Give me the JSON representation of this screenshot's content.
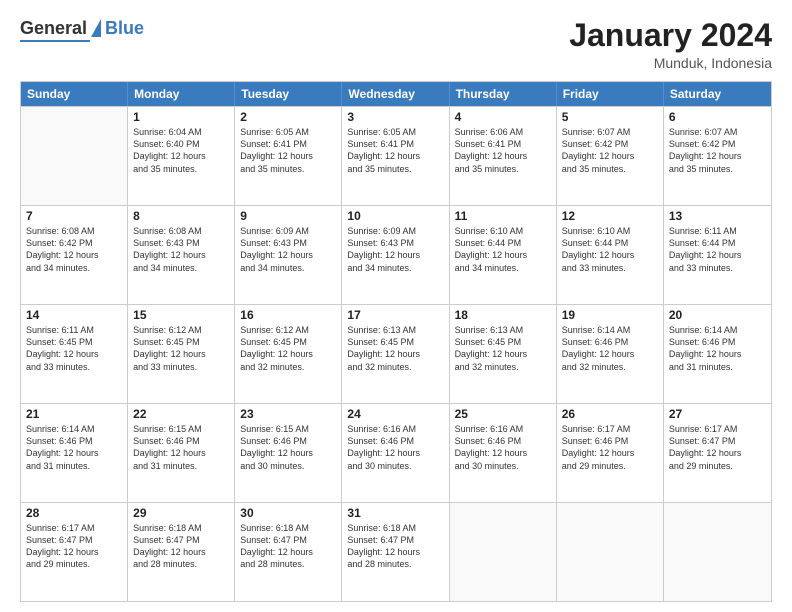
{
  "logo": {
    "general": "General",
    "blue": "Blue"
  },
  "title": "January 2024",
  "location": "Munduk, Indonesia",
  "days": [
    "Sunday",
    "Monday",
    "Tuesday",
    "Wednesday",
    "Thursday",
    "Friday",
    "Saturday"
  ],
  "rows": [
    [
      {
        "day": "",
        "empty": true
      },
      {
        "day": "1",
        "sunrise": "6:04 AM",
        "sunset": "6:40 PM",
        "daylight": "12 hours and 35 minutes."
      },
      {
        "day": "2",
        "sunrise": "6:05 AM",
        "sunset": "6:41 PM",
        "daylight": "12 hours and 35 minutes."
      },
      {
        "day": "3",
        "sunrise": "6:05 AM",
        "sunset": "6:41 PM",
        "daylight": "12 hours and 35 minutes."
      },
      {
        "day": "4",
        "sunrise": "6:06 AM",
        "sunset": "6:41 PM",
        "daylight": "12 hours and 35 minutes."
      },
      {
        "day": "5",
        "sunrise": "6:07 AM",
        "sunset": "6:42 PM",
        "daylight": "12 hours and 35 minutes."
      },
      {
        "day": "6",
        "sunrise": "6:07 AM",
        "sunset": "6:42 PM",
        "daylight": "12 hours and 35 minutes."
      }
    ],
    [
      {
        "day": "7",
        "sunrise": "6:08 AM",
        "sunset": "6:42 PM",
        "daylight": "12 hours and 34 minutes."
      },
      {
        "day": "8",
        "sunrise": "6:08 AM",
        "sunset": "6:43 PM",
        "daylight": "12 hours and 34 minutes."
      },
      {
        "day": "9",
        "sunrise": "6:09 AM",
        "sunset": "6:43 PM",
        "daylight": "12 hours and 34 minutes."
      },
      {
        "day": "10",
        "sunrise": "6:09 AM",
        "sunset": "6:43 PM",
        "daylight": "12 hours and 34 minutes."
      },
      {
        "day": "11",
        "sunrise": "6:10 AM",
        "sunset": "6:44 PM",
        "daylight": "12 hours and 34 minutes."
      },
      {
        "day": "12",
        "sunrise": "6:10 AM",
        "sunset": "6:44 PM",
        "daylight": "12 hours and 33 minutes."
      },
      {
        "day": "13",
        "sunrise": "6:11 AM",
        "sunset": "6:44 PM",
        "daylight": "12 hours and 33 minutes."
      }
    ],
    [
      {
        "day": "14",
        "sunrise": "6:11 AM",
        "sunset": "6:45 PM",
        "daylight": "12 hours and 33 minutes."
      },
      {
        "day": "15",
        "sunrise": "6:12 AM",
        "sunset": "6:45 PM",
        "daylight": "12 hours and 33 minutes."
      },
      {
        "day": "16",
        "sunrise": "6:12 AM",
        "sunset": "6:45 PM",
        "daylight": "12 hours and 32 minutes."
      },
      {
        "day": "17",
        "sunrise": "6:13 AM",
        "sunset": "6:45 PM",
        "daylight": "12 hours and 32 minutes."
      },
      {
        "day": "18",
        "sunrise": "6:13 AM",
        "sunset": "6:45 PM",
        "daylight": "12 hours and 32 minutes."
      },
      {
        "day": "19",
        "sunrise": "6:14 AM",
        "sunset": "6:46 PM",
        "daylight": "12 hours and 32 minutes."
      },
      {
        "day": "20",
        "sunrise": "6:14 AM",
        "sunset": "6:46 PM",
        "daylight": "12 hours and 31 minutes."
      }
    ],
    [
      {
        "day": "21",
        "sunrise": "6:14 AM",
        "sunset": "6:46 PM",
        "daylight": "12 hours and 31 minutes."
      },
      {
        "day": "22",
        "sunrise": "6:15 AM",
        "sunset": "6:46 PM",
        "daylight": "12 hours and 31 minutes."
      },
      {
        "day": "23",
        "sunrise": "6:15 AM",
        "sunset": "6:46 PM",
        "daylight": "12 hours and 30 minutes."
      },
      {
        "day": "24",
        "sunrise": "6:16 AM",
        "sunset": "6:46 PM",
        "daylight": "12 hours and 30 minutes."
      },
      {
        "day": "25",
        "sunrise": "6:16 AM",
        "sunset": "6:46 PM",
        "daylight": "12 hours and 30 minutes."
      },
      {
        "day": "26",
        "sunrise": "6:17 AM",
        "sunset": "6:46 PM",
        "daylight": "12 hours and 29 minutes."
      },
      {
        "day": "27",
        "sunrise": "6:17 AM",
        "sunset": "6:47 PM",
        "daylight": "12 hours and 29 minutes."
      }
    ],
    [
      {
        "day": "28",
        "sunrise": "6:17 AM",
        "sunset": "6:47 PM",
        "daylight": "12 hours and 29 minutes."
      },
      {
        "day": "29",
        "sunrise": "6:18 AM",
        "sunset": "6:47 PM",
        "daylight": "12 hours and 28 minutes."
      },
      {
        "day": "30",
        "sunrise": "6:18 AM",
        "sunset": "6:47 PM",
        "daylight": "12 hours and 28 minutes."
      },
      {
        "day": "31",
        "sunrise": "6:18 AM",
        "sunset": "6:47 PM",
        "daylight": "12 hours and 28 minutes."
      },
      {
        "day": "",
        "empty": true
      },
      {
        "day": "",
        "empty": true
      },
      {
        "day": "",
        "empty": true
      }
    ]
  ]
}
